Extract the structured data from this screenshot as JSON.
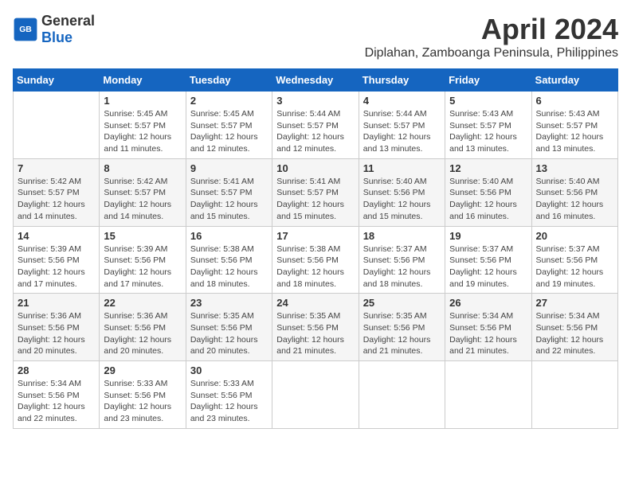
{
  "header": {
    "logo_general": "General",
    "logo_blue": "Blue",
    "month_year": "April 2024",
    "location": "Diplahan, Zamboanga Peninsula, Philippines"
  },
  "weekdays": [
    "Sunday",
    "Monday",
    "Tuesday",
    "Wednesday",
    "Thursday",
    "Friday",
    "Saturday"
  ],
  "weeks": [
    [
      {
        "day": "",
        "sunrise": "",
        "sunset": "",
        "daylight": ""
      },
      {
        "day": "1",
        "sunrise": "5:45 AM",
        "sunset": "5:57 PM",
        "daylight": "12 hours and 11 minutes."
      },
      {
        "day": "2",
        "sunrise": "5:45 AM",
        "sunset": "5:57 PM",
        "daylight": "12 hours and 12 minutes."
      },
      {
        "day": "3",
        "sunrise": "5:44 AM",
        "sunset": "5:57 PM",
        "daylight": "12 hours and 12 minutes."
      },
      {
        "day": "4",
        "sunrise": "5:44 AM",
        "sunset": "5:57 PM",
        "daylight": "12 hours and 13 minutes."
      },
      {
        "day": "5",
        "sunrise": "5:43 AM",
        "sunset": "5:57 PM",
        "daylight": "12 hours and 13 minutes."
      },
      {
        "day": "6",
        "sunrise": "5:43 AM",
        "sunset": "5:57 PM",
        "daylight": "12 hours and 13 minutes."
      }
    ],
    [
      {
        "day": "7",
        "sunrise": "5:42 AM",
        "sunset": "5:57 PM",
        "daylight": "12 hours and 14 minutes."
      },
      {
        "day": "8",
        "sunrise": "5:42 AM",
        "sunset": "5:57 PM",
        "daylight": "12 hours and 14 minutes."
      },
      {
        "day": "9",
        "sunrise": "5:41 AM",
        "sunset": "5:57 PM",
        "daylight": "12 hours and 15 minutes."
      },
      {
        "day": "10",
        "sunrise": "5:41 AM",
        "sunset": "5:57 PM",
        "daylight": "12 hours and 15 minutes."
      },
      {
        "day": "11",
        "sunrise": "5:40 AM",
        "sunset": "5:56 PM",
        "daylight": "12 hours and 15 minutes."
      },
      {
        "day": "12",
        "sunrise": "5:40 AM",
        "sunset": "5:56 PM",
        "daylight": "12 hours and 16 minutes."
      },
      {
        "day": "13",
        "sunrise": "5:40 AM",
        "sunset": "5:56 PM",
        "daylight": "12 hours and 16 minutes."
      }
    ],
    [
      {
        "day": "14",
        "sunrise": "5:39 AM",
        "sunset": "5:56 PM",
        "daylight": "12 hours and 17 minutes."
      },
      {
        "day": "15",
        "sunrise": "5:39 AM",
        "sunset": "5:56 PM",
        "daylight": "12 hours and 17 minutes."
      },
      {
        "day": "16",
        "sunrise": "5:38 AM",
        "sunset": "5:56 PM",
        "daylight": "12 hours and 18 minutes."
      },
      {
        "day": "17",
        "sunrise": "5:38 AM",
        "sunset": "5:56 PM",
        "daylight": "12 hours and 18 minutes."
      },
      {
        "day": "18",
        "sunrise": "5:37 AM",
        "sunset": "5:56 PM",
        "daylight": "12 hours and 18 minutes."
      },
      {
        "day": "19",
        "sunrise": "5:37 AM",
        "sunset": "5:56 PM",
        "daylight": "12 hours and 19 minutes."
      },
      {
        "day": "20",
        "sunrise": "5:37 AM",
        "sunset": "5:56 PM",
        "daylight": "12 hours and 19 minutes."
      }
    ],
    [
      {
        "day": "21",
        "sunrise": "5:36 AM",
        "sunset": "5:56 PM",
        "daylight": "12 hours and 20 minutes."
      },
      {
        "day": "22",
        "sunrise": "5:36 AM",
        "sunset": "5:56 PM",
        "daylight": "12 hours and 20 minutes."
      },
      {
        "day": "23",
        "sunrise": "5:35 AM",
        "sunset": "5:56 PM",
        "daylight": "12 hours and 20 minutes."
      },
      {
        "day": "24",
        "sunrise": "5:35 AM",
        "sunset": "5:56 PM",
        "daylight": "12 hours and 21 minutes."
      },
      {
        "day": "25",
        "sunrise": "5:35 AM",
        "sunset": "5:56 PM",
        "daylight": "12 hours and 21 minutes."
      },
      {
        "day": "26",
        "sunrise": "5:34 AM",
        "sunset": "5:56 PM",
        "daylight": "12 hours and 21 minutes."
      },
      {
        "day": "27",
        "sunrise": "5:34 AM",
        "sunset": "5:56 PM",
        "daylight": "12 hours and 22 minutes."
      }
    ],
    [
      {
        "day": "28",
        "sunrise": "5:34 AM",
        "sunset": "5:56 PM",
        "daylight": "12 hours and 22 minutes."
      },
      {
        "day": "29",
        "sunrise": "5:33 AM",
        "sunset": "5:56 PM",
        "daylight": "12 hours and 23 minutes."
      },
      {
        "day": "30",
        "sunrise": "5:33 AM",
        "sunset": "5:56 PM",
        "daylight": "12 hours and 23 minutes."
      },
      {
        "day": "",
        "sunrise": "",
        "sunset": "",
        "daylight": ""
      },
      {
        "day": "",
        "sunrise": "",
        "sunset": "",
        "daylight": ""
      },
      {
        "day": "",
        "sunrise": "",
        "sunset": "",
        "daylight": ""
      },
      {
        "day": "",
        "sunrise": "",
        "sunset": "",
        "daylight": ""
      }
    ]
  ],
  "labels": {
    "sunrise_prefix": "Sunrise: ",
    "sunset_prefix": "Sunset: ",
    "daylight_prefix": "Daylight: "
  }
}
